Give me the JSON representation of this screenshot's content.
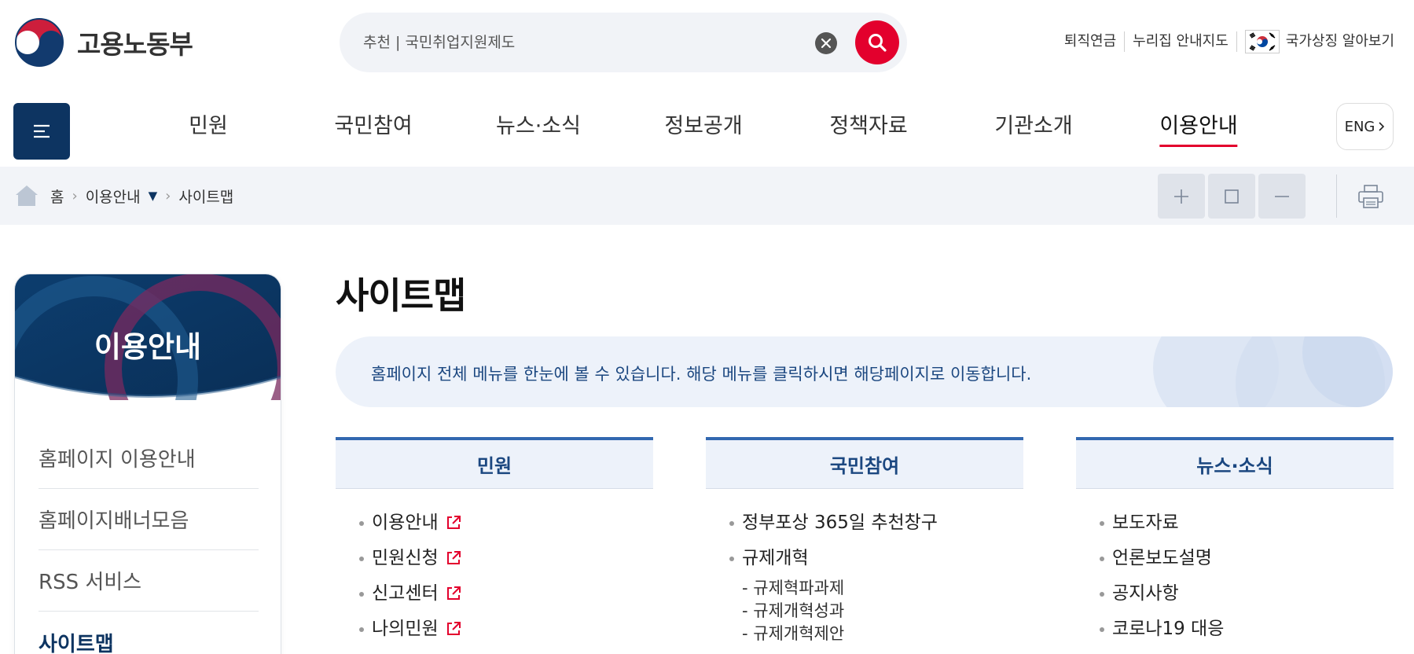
{
  "header": {
    "logo_text": "고용노동부",
    "search": {
      "placeholder": "추천 | 국민취업지원제도"
    },
    "util_links": [
      "퇴직연금",
      "누리집 안내지도",
      "국가상징 알아보기"
    ]
  },
  "gnb": {
    "items": [
      {
        "label": "민원"
      },
      {
        "label": "국민참여"
      },
      {
        "label": "뉴스·소식"
      },
      {
        "label": "정보공개"
      },
      {
        "label": "정책자료"
      },
      {
        "label": "기관소개"
      },
      {
        "label": "이용안내"
      }
    ],
    "active_index": 6,
    "eng_label": "ENG"
  },
  "breadcrumb": {
    "items": [
      "홈",
      "이용안내",
      "사이트맵"
    ]
  },
  "side_nav": {
    "title": "이용안내",
    "items": [
      {
        "label": "홈페이지 이용안내"
      },
      {
        "label": "홈페이지배너모음"
      },
      {
        "label": "RSS 서비스"
      },
      {
        "label": "사이트맵"
      }
    ]
  },
  "content": {
    "title": "사이트맵",
    "intro": "홈페이지 전체 메뉴를 한눈에 볼 수 있습니다. 해당 메뉴를 클릭하시면 해당페이지로 이동합니다.",
    "columns": [
      {
        "heading": "민원",
        "items": [
          {
            "label": "이용안내"
          },
          {
            "label": "민원신청"
          },
          {
            "label": "신고센터"
          },
          {
            "label": "나의민원"
          }
        ]
      },
      {
        "heading": "국민참여",
        "items": [
          {
            "label": "정부포상 365일 추천창구"
          },
          {
            "label": "규제개혁"
          }
        ],
        "sub_items": [
          "- 규제혁파과제",
          "- 규제개혁성과",
          "- 규제개혁제안"
        ]
      },
      {
        "heading": "뉴스·소식",
        "items": [
          {
            "label": "보도자료"
          },
          {
            "label": "언론보도설명"
          },
          {
            "label": "공지사항"
          },
          {
            "label": "코로나19 대응"
          }
        ]
      }
    ]
  },
  "colors": {
    "brand_navy": "#0d3461",
    "accent_red": "#e3002d",
    "link_blue": "#1b4780",
    "panel_bg": "#edf2fa"
  }
}
